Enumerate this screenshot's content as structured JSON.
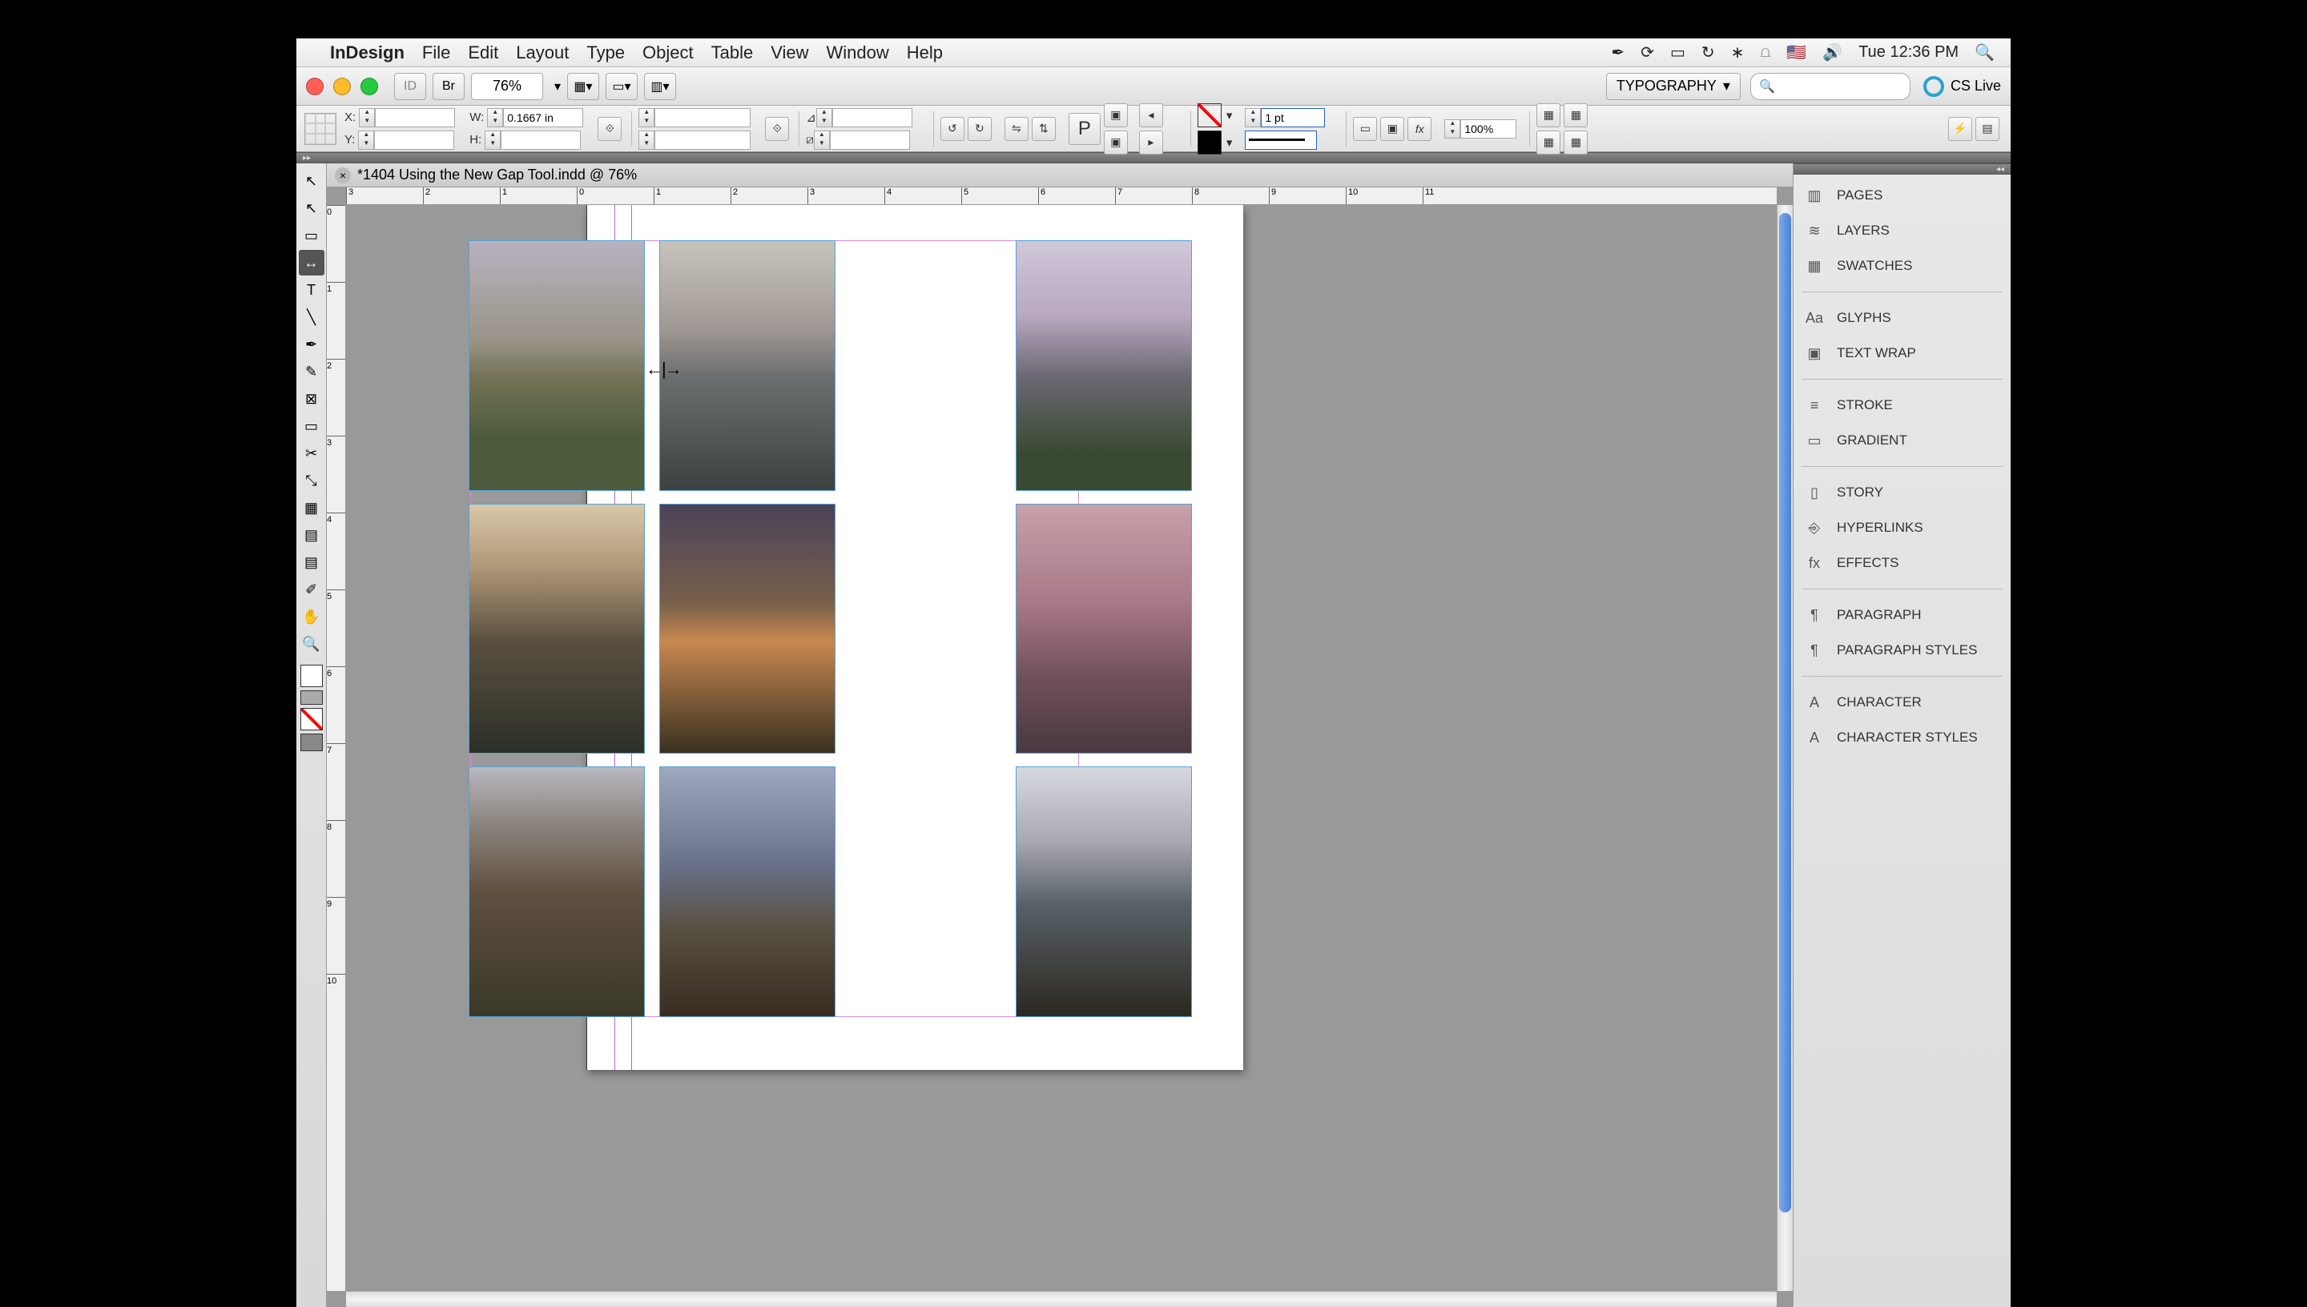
{
  "menubar": {
    "app": "InDesign",
    "items": [
      "File",
      "Edit",
      "Layout",
      "Type",
      "Object",
      "Table",
      "View",
      "Window",
      "Help"
    ],
    "clock": "Tue 12:36 PM"
  },
  "app_chrome": {
    "zoom": "76%",
    "workspace": "TYPOGRAPHY",
    "cslive": "CS Live"
  },
  "control_panel": {
    "x_label": "X:",
    "x_value": "",
    "y_label": "Y:",
    "y_value": "",
    "w_label": "W:",
    "w_value": "0.1667 in",
    "h_label": "H:",
    "h_value": "",
    "rotate_label": "",
    "shear_label": "",
    "stroke_weight": "1 pt",
    "opacity": "100%"
  },
  "document": {
    "tab_title": "*1404 Using the New Gap Tool.indd @ 76%",
    "ruler_h_ticks": [
      "3",
      "2",
      "1",
      "0",
      "1",
      "2",
      "3",
      "4",
      "5",
      "6",
      "7",
      "8",
      "9",
      "10",
      "11"
    ],
    "ruler_v_ticks": [
      "0",
      "1",
      "2",
      "3",
      "4",
      "5",
      "6",
      "7",
      "8",
      "9",
      "10"
    ]
  },
  "panels": {
    "group1": [
      {
        "icon": "pages-icon",
        "label": "PAGES"
      },
      {
        "icon": "layers-icon",
        "label": "LAYERS"
      },
      {
        "icon": "swatches-icon",
        "label": "SWATCHES"
      }
    ],
    "group2": [
      {
        "icon": "glyphs-icon",
        "label": "GLYPHS"
      },
      {
        "icon": "textwrap-icon",
        "label": "TEXT WRAP"
      }
    ],
    "group3": [
      {
        "icon": "stroke-icon",
        "label": "STROKE"
      },
      {
        "icon": "gradient-icon",
        "label": "GRADIENT"
      }
    ],
    "group4": [
      {
        "icon": "story-icon",
        "label": "STORY"
      },
      {
        "icon": "hyperlinks-icon",
        "label": "HYPERLINKS"
      },
      {
        "icon": "effects-icon",
        "label": "EFFECTS"
      }
    ],
    "group5": [
      {
        "icon": "paragraph-icon",
        "label": "PARAGRAPH"
      },
      {
        "icon": "paragraph-styles-icon",
        "label": "PARAGRAPH STYLES"
      }
    ],
    "group6": [
      {
        "icon": "character-icon",
        "label": "CHARACTER"
      },
      {
        "icon": "character-styles-icon",
        "label": "CHARACTER STYLES"
      }
    ]
  },
  "tools": [
    {
      "name": "selection-tool",
      "glyph": "↖",
      "active": false
    },
    {
      "name": "direct-selection-tool",
      "glyph": "↖",
      "active": false
    },
    {
      "name": "page-tool",
      "glyph": "▭",
      "active": false
    },
    {
      "name": "gap-tool",
      "glyph": "↔",
      "active": true
    },
    {
      "name": "type-tool",
      "glyph": "T",
      "active": false
    },
    {
      "name": "line-tool",
      "glyph": "╲",
      "active": false
    },
    {
      "name": "pen-tool",
      "glyph": "✒",
      "active": false
    },
    {
      "name": "pencil-tool",
      "glyph": "✎",
      "active": false
    },
    {
      "name": "rectangle-frame-tool",
      "glyph": "⊠",
      "active": false
    },
    {
      "name": "rectangle-tool",
      "glyph": "▭",
      "active": false
    },
    {
      "name": "scissors-tool",
      "glyph": "✂",
      "active": false
    },
    {
      "name": "free-transform-tool",
      "glyph": "⤡",
      "active": false
    },
    {
      "name": "gradient-swatch-tool",
      "glyph": "▦",
      "active": false
    },
    {
      "name": "gradient-feather-tool",
      "glyph": "▤",
      "active": false
    },
    {
      "name": "note-tool",
      "glyph": "▤",
      "active": false
    },
    {
      "name": "eyedropper-tool",
      "glyph": "✐",
      "active": false
    },
    {
      "name": "hand-tool",
      "glyph": "✋",
      "active": false
    },
    {
      "name": "zoom-tool",
      "glyph": "🔍",
      "active": false
    }
  ],
  "images": [
    {
      "name": "image-1-1",
      "class": "sky1"
    },
    {
      "name": "image-1-2",
      "class": "sky2"
    },
    {
      "name": "image-1-3",
      "class": "sky3"
    },
    {
      "name": "image-2-1",
      "class": "sky4"
    },
    {
      "name": "image-2-2",
      "class": "sky5"
    },
    {
      "name": "image-2-3",
      "class": "sky6"
    },
    {
      "name": "image-3-1",
      "class": "sky7"
    },
    {
      "name": "image-3-2",
      "class": "sky8"
    },
    {
      "name": "image-3-3",
      "class": "sky9"
    }
  ]
}
